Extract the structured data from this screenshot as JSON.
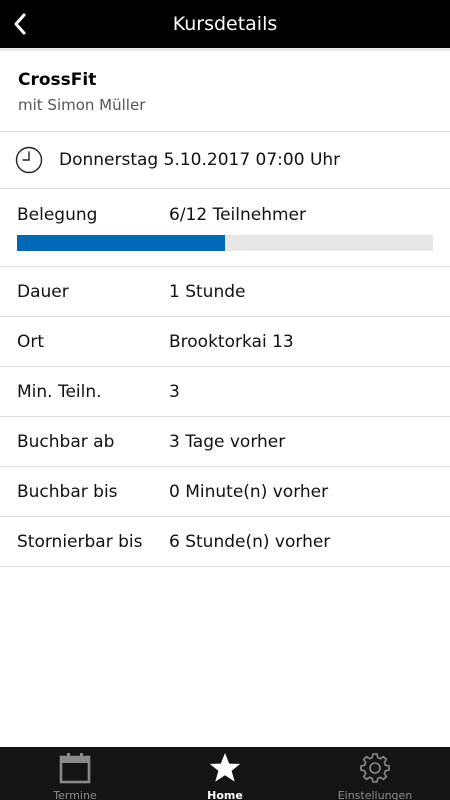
{
  "header": {
    "title": "Kursdetails",
    "back_icon": "chevron-left-icon"
  },
  "course": {
    "name": "CrossFit",
    "trainer": "mit Simon Müller"
  },
  "schedule": {
    "icon": "clock-icon",
    "datetime": "Donnerstag 5.10.2017 07:00 Uhr"
  },
  "occupancy": {
    "label": "Belegung",
    "value": "6/12 Teilnehmer",
    "booked": 6,
    "capacity": 12,
    "fill_fraction": 0.5,
    "bar_color": "#0068b8"
  },
  "details": [
    {
      "label": "Dauer",
      "value": "1 Stunde"
    },
    {
      "label": "Ort",
      "value": "Brooktorkai 13"
    },
    {
      "label": "Min. Teiln.",
      "value": "3"
    },
    {
      "label": "Buchbar ab",
      "value": "3 Tage vorher"
    },
    {
      "label": "Buchbar bis",
      "value": "0 Minute(n) vorher"
    },
    {
      "label": "Stornierbar bis",
      "value": "6 Stunde(n) vorher"
    }
  ],
  "nav": {
    "items": [
      {
        "label": "Termine",
        "icon": "calendar-icon",
        "active": false
      },
      {
        "label": "Home",
        "icon": "star-icon",
        "active": true
      },
      {
        "label": "Einstellungen",
        "icon": "gear-icon",
        "active": false
      }
    ]
  }
}
